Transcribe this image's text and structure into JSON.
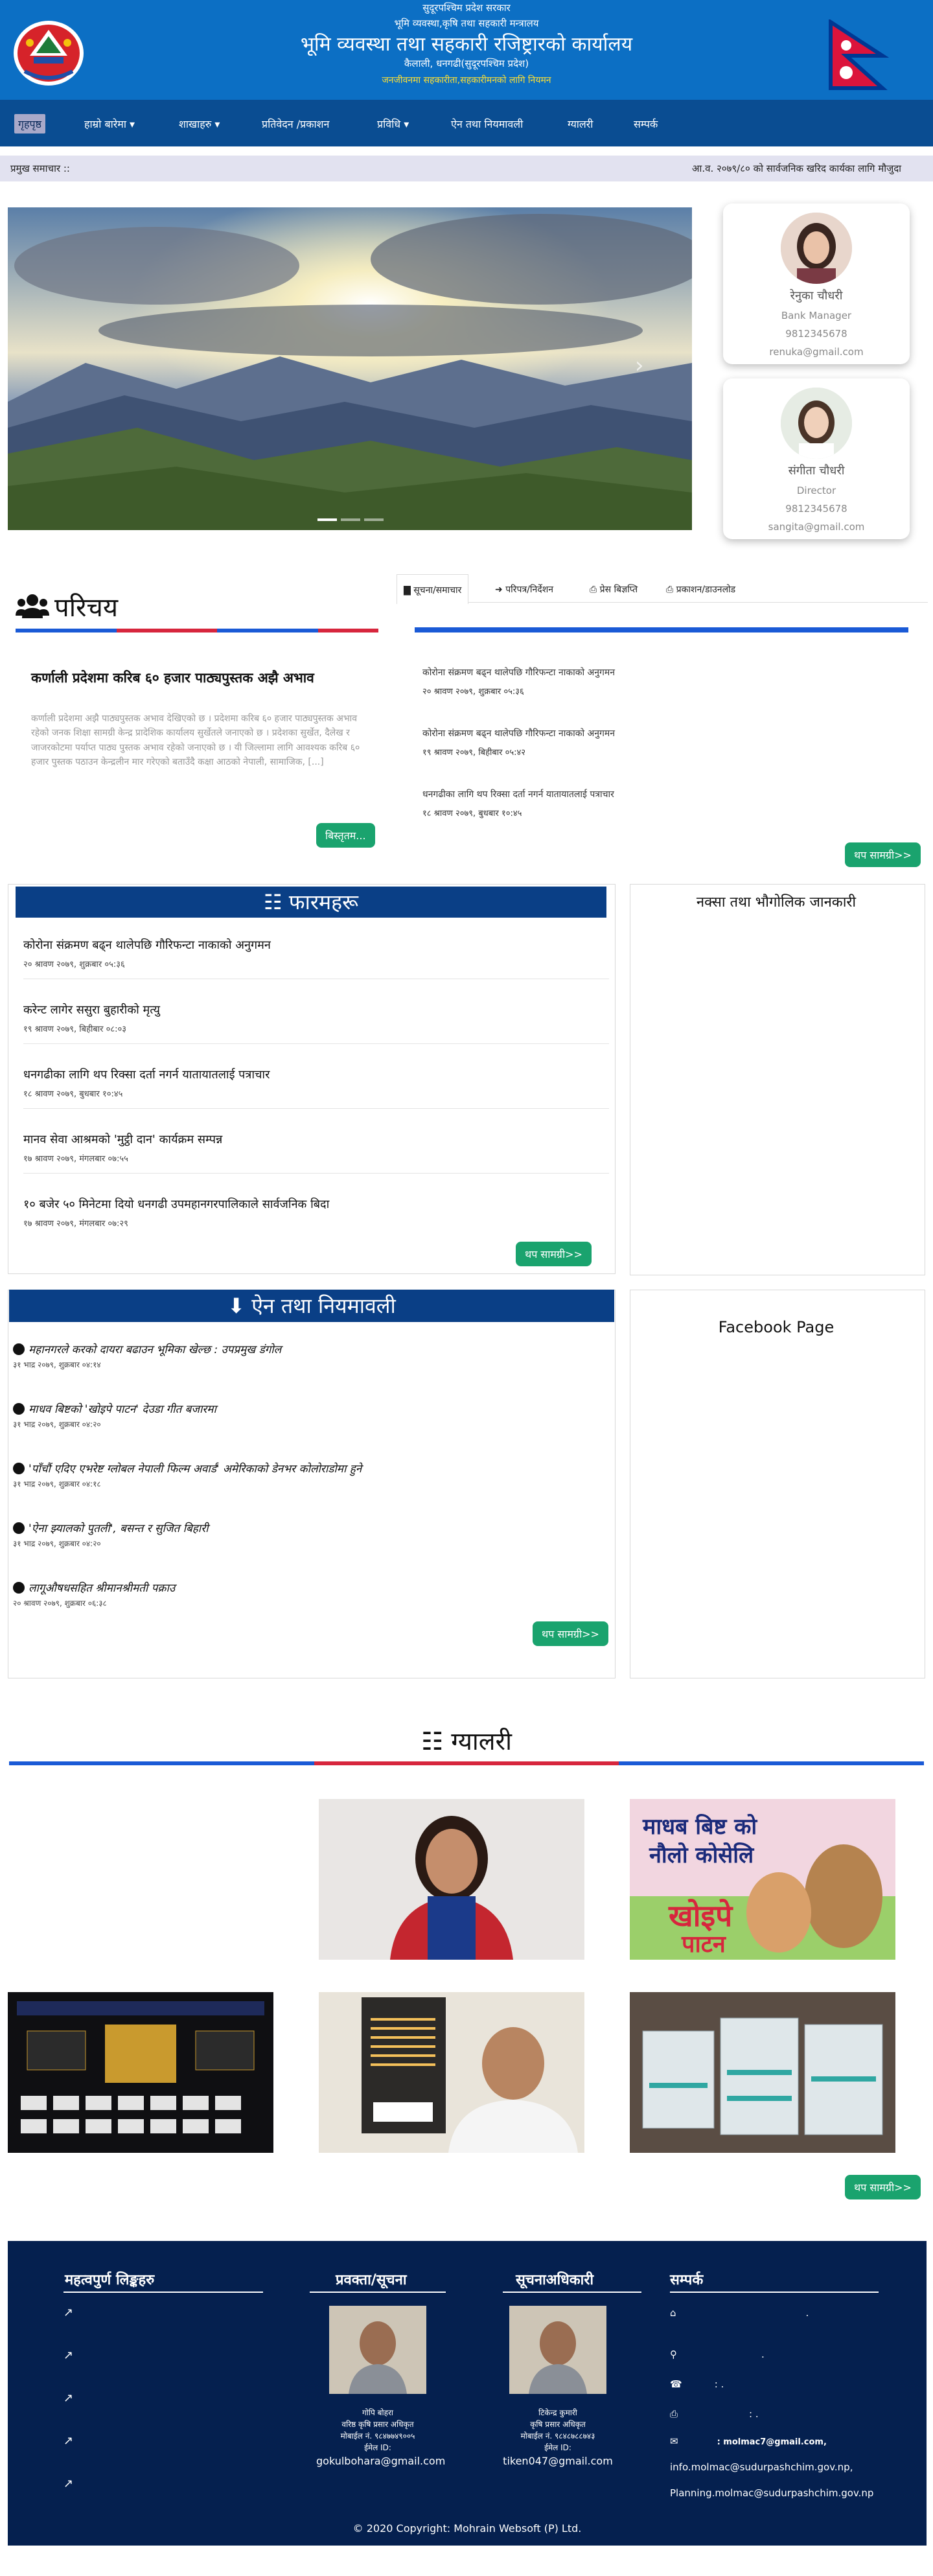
{
  "header": {
    "line1": "सुदूरपश्चिम प्रदेश सरकार",
    "line2": "भूमि व्यवस्था,कृषि तथा सहकारी मन्त्रालय",
    "title": "भूमि व्यवस्था तथा सहकारी रजिष्ट्रारको कार्यालय",
    "line4": "कैलाली, धनगढी(सुदूरपश्चिम प्रदेश)",
    "slogan": "जनजीवनमा सहकारीता,सहकारीमनको लागि नियमन"
  },
  "nav": {
    "items": [
      {
        "label": "गृहपृष्ठ"
      },
      {
        "label": "हाम्रो बारेमा ▾"
      },
      {
        "label": "शाखाहरु ▾"
      },
      {
        "label": "प्रतिवेदन /प्रकाशन"
      },
      {
        "label": "प्रविधि ▾"
      },
      {
        "label": "ऐन तथा नियमावली"
      },
      {
        "label": "ग्यालरी"
      },
      {
        "label": "सम्पर्क"
      }
    ]
  },
  "ticker": {
    "label": "प्रमुख समाचार ::",
    "text": "आ.व. २०७९/८० को सार्वजनिक खरिद कार्यका लागि मौजुदा"
  },
  "profiles": [
    {
      "name": "रेनुका चौधरी",
      "role": "Bank Manager",
      "phone": "9812345678",
      "email": "renuka@gmail.com"
    },
    {
      "name": "संगीता चौधरी",
      "role": "Director",
      "phone": "9812345678",
      "email": "sangita@gmail.com"
    }
  ],
  "intro": {
    "title": "परिचय",
    "headline": "कर्णाली प्रदेशमा करिब ६० हजार पाठ्यपुस्तक अझै अभाव",
    "body": "कर्णाली प्रदेशमा अझै पाठ्यपुस्तक अभाव देखिएको छ । प्रदेशमा करिब ६० हजार पाठ्यपुस्तक अभाव रहेको जनक शिक्षा सामग्री केन्द्र प्रादेशिक कार्यालय सुर्खेतले जनाएको छ । प्रदेशका सुर्खेत, दैलेख र जाजरकोटमा पर्याप्त पाठ्य पुस्तक अभाव रहेको जनाएको छ । यी जिल्लामा लागि आवश्यक करिब ६० हजार पुस्तक पठाउन केन्द्रलीन मार गरेएको बताउँदै कक्षा आठको नेपाली, सामाजिक, [...]",
    "button": "बिस्तृतम..."
  },
  "tabs": {
    "items": [
      {
        "label": "सूचना/समाचार"
      },
      {
        "label": "परिपत्र/निर्देशन"
      },
      {
        "label": "प्रेस बिज्ञप्ति"
      },
      {
        "label": "प्रकाशन/डाउनलोड"
      }
    ],
    "news": [
      {
        "title": "कोरोना संक्रमण बढ्न थालेपछि गौरिफन्टा नाकाको अनुगमन",
        "date": "२० श्रावण २०७९, शुक्रबार ०५:३६"
      },
      {
        "title": "कोरोना संक्रमण बढ्न थालेपछि गौरिफन्टा नाकाको अनुगमन",
        "date": "१९ श्रावण २०७९, बिहीबार ०५:४२"
      },
      {
        "title": "धनगढीका लागि थप रिक्सा दर्ता नगर्न यातायातलाई पत्राचार",
        "date": "१८ श्रावण २०७९, बुधबार १०:४५"
      }
    ],
    "more": "थप सामग्री>>"
  },
  "forms": {
    "title": "फारमहरू",
    "items": [
      {
        "title": "कोरोना संक्रमण बढ्न थालेपछि गौरिफन्टा नाकाको अनुगमन",
        "date": "२० श्रावण २०७९, शुक्रबार ०५:३६"
      },
      {
        "title": "करेन्ट लागेर ससुरा बुहारीको मृत्यु",
        "date": "१९ श्रावण २०७९, बिहीबार ०८:०३"
      },
      {
        "title": "धनगढीका लागि थप रिक्सा दर्ता नगर्न यातायातलाई पत्राचार",
        "date": "१८ श्रावण २०७९, बुधबार १०:४५"
      },
      {
        "title": "मानव सेवा आश्रमको 'मुट्ठी दान' कार्यक्रम सम्पन्न",
        "date": "१७ श्रावण २०७९, मंगलबार ०७:५५"
      },
      {
        "title": "१० बजेर ५० मिनेटमा दियो धनगढी उपमहानगरपालिकाले सार्वजनिक बिदा",
        "date": "१७ श्रावण २०७९, मंगलबार ०७:२९"
      }
    ],
    "more": "थप सामग्री>>"
  },
  "map": {
    "title": "नक्सा तथा भौगोलिक जानकारी"
  },
  "laws": {
    "title": "ऐन तथा नियमावली",
    "items": [
      {
        "title": "महानगरले करको दायरा बढाउन भूमिका खेल्छ : उपप्रमुख डंगोल",
        "date": "३१ भाद्र २०७९, शुक्रबार ०४:१४"
      },
      {
        "title": "माधव बिष्टको 'खोइपे पाटन' देउडा गीत बजारमा",
        "date": "३१ भाद्र २०७९, शुक्रबार ०४:२०"
      },
      {
        "title": "'पाँचौं एदिए एभरेष्ट ग्लोबल नेपाली फिल्म अवार्ड' अमेरिकाको डेनभर कोलोराडोमा हुने",
        "date": "३१ भाद्र २०७९, शुक्रबार ०४:१८"
      },
      {
        "title": "'ऐना झ्यालको पुतली', बसन्त र सुजित बिहारी",
        "date": "३१ भाद्र २०७९, शुक्रबार ०४:२०"
      },
      {
        "title": "लागूऔषधसहित श्रीमानश्रीमती पक्राउ",
        "date": "२० श्रावण २०७९, शुक्रबार ०६:३८"
      }
    ],
    "more": "थप सामग्री>>"
  },
  "facebook": {
    "title": "Facebook Page"
  },
  "gallery": {
    "title": "ग्यालरी",
    "poster_title_1": "माधब बिष्ट को",
    "poster_title_2": "नौलो कोसेलि",
    "poster_title_3": "खोइपे",
    "poster_title_4": "पाटन",
    "more": "थप सामग्री>>"
  },
  "footer": {
    "links_title": "महत्वपुर्ण लिङ्कहरु",
    "spokes_title": "प्रवक्ता/सूचना",
    "info_title": "सूचनाअधिकारी",
    "contact_title": "सम्पर्क",
    "spokesperson": {
      "name": "गोपि बोहरा",
      "post": "वरिष्ठ कृषि प्रसार अधिकृत",
      "mobile": "मोबाईल नं. ९८४७७४९००५",
      "email_label": "ईमेल ID:",
      "email": "gokulbohara@gmail.com"
    },
    "info_officer": {
      "name": "टिकेन्द्र कुमारी",
      "post": "कृषि प्रसार अधिकृत",
      "mobile": "मोबाईल नं. ९८४८७८८७४३",
      "email_label": "ईमेल ID:",
      "email": "tiken047@gmail.com"
    },
    "contact": {
      "c1": ".",
      "c2": ".",
      "c3": ":      .",
      "c4": ":      .",
      "c5": ": molmac7@gmail.com,",
      "c6": "info.molmac@sudurpashchim.gov.np,",
      "c7": "Planning.molmac@sudurpashchim.gov.np"
    },
    "copyright": "© 2020 Copyright: Mohrain Websoft (P) Ltd."
  }
}
